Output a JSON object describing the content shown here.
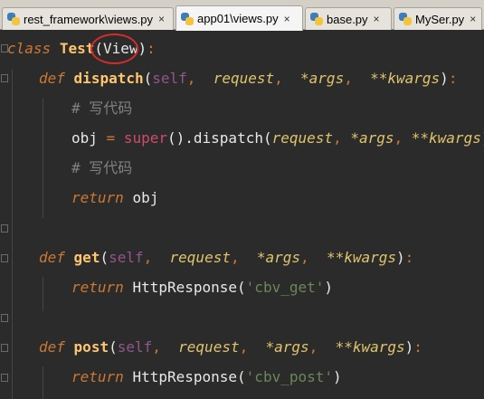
{
  "tabs": [
    {
      "label": "rest_framework\\views.py",
      "close": "×",
      "active": false
    },
    {
      "label": "app01\\views.py",
      "close": "×",
      "active": true
    },
    {
      "label": "base.py",
      "close": "×",
      "active": false
    },
    {
      "label": "MySer.py",
      "close": "×",
      "active": false
    }
  ],
  "code": {
    "line1": {
      "kw": "class",
      "name": "Test",
      "open": "(",
      "base": "View",
      "close": ")",
      "colon": ":"
    },
    "dispatch": {
      "kw": "def",
      "name": "dispatch",
      "open": "(",
      "self": "self",
      "c1": ",",
      "p1": "request",
      "c2": ",",
      "p2": "*args",
      "c3": ",",
      "p3": "**kwargs",
      "close": ")",
      "colon": ":"
    },
    "comment1": "# 写代码",
    "objline": {
      "var": "obj",
      "eq": "=",
      "sup": "super",
      "call": "().dispatch(",
      "p1": "request",
      "c1": ",",
      "p2": "*args",
      "c2": ",",
      "p3": "**kwargs",
      "close": ")"
    },
    "comment2": "# 写代码",
    "return_obj": {
      "kw": "return",
      "val": "obj"
    },
    "get": {
      "kw": "def",
      "name": "get",
      "open": "(",
      "self": "self",
      "c1": ",",
      "p1": "request",
      "c2": ",",
      "p2": "*args",
      "c3": ",",
      "p3": "**kwargs",
      "close": ")",
      "colon": ":"
    },
    "return_get": {
      "kw": "return",
      "call": "HttpResponse(",
      "str": "'cbv_get'",
      "close": ")"
    },
    "post": {
      "kw": "def",
      "name": "post",
      "open": "(",
      "self": "self",
      "c1": ",",
      "p1": "request",
      "c2": ",",
      "p2": "*args",
      "c3": ",",
      "p3": "**kwargs",
      "close": ")",
      "colon": ":"
    },
    "return_post": {
      "kw": "return",
      "call": "HttpResponse(",
      "str": "'cbv_post'",
      "close": ")"
    }
  },
  "colors": {
    "background": "#2b2b2b",
    "keyword": "#cc7832",
    "function_name": "#ffc66d",
    "self": "#94558d",
    "parameter": "#e0c46c",
    "comment": "#808080",
    "string": "#6a8759",
    "annotation": "#d62b2b"
  }
}
